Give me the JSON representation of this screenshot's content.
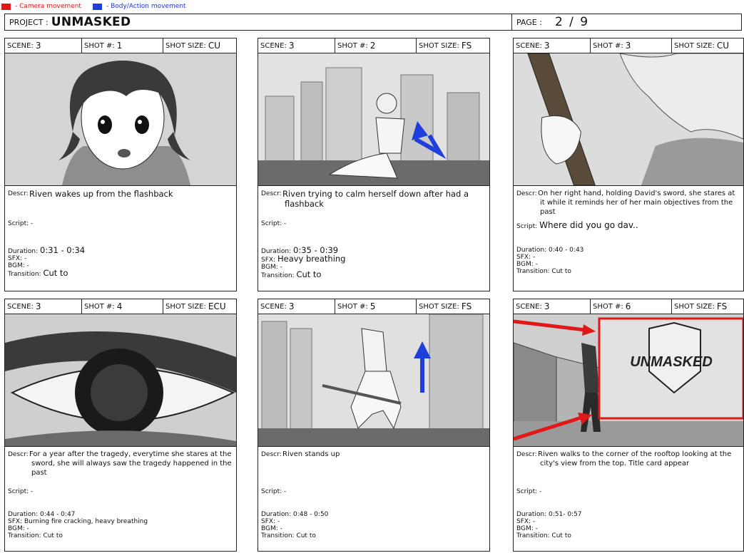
{
  "legend": {
    "camera_label": "- Camera movement",
    "body_label": "- Body/Action movement",
    "camera_color": "#e01818",
    "body_color": "#1f3fd9"
  },
  "header": {
    "project_label": "PROJECT :",
    "project_title": "UNMASKED",
    "page_label": "PAGE :",
    "page_value": "2 / 9"
  },
  "labels": {
    "scene": "SCENE:",
    "shot": "SHOT #:",
    "size": "SHOT SIZE:",
    "descr": "Descr:",
    "script": "Script:",
    "duration": "Duration:",
    "sfx": "SFX:",
    "bgm": "BGM:",
    "transition": "Transition:"
  },
  "panels": [
    {
      "scene": "3",
      "shot": "1",
      "size": "CU",
      "descr": "Riven wakes up from the flashback",
      "script": "-",
      "duration": "0:31 - 0:34",
      "sfx": "-",
      "bgm": "-",
      "transition": "Cut to"
    },
    {
      "scene": "3",
      "shot": "2",
      "size": "FS",
      "descr": "Riven trying to calm herself down after had a flashback",
      "script": "-",
      "duration": "0:35 - 0:39",
      "sfx": "Heavy breathing",
      "bgm": "-",
      "transition": "Cut to"
    },
    {
      "scene": "3",
      "shot": "3",
      "size": "CU",
      "descr": "On her right hand, holding David's sword, she stares at it while it reminds her of her main objectives from the past",
      "script": "Where did you go dav..",
      "duration": "0:40 - 0:43",
      "sfx": "-",
      "bgm": "-",
      "transition": "Cut to"
    },
    {
      "scene": "3",
      "shot": "4",
      "size": "ECU",
      "descr": "For a year after the tragedy, everytime she stares at the sword, she will always saw the tragedy happened in the past",
      "script": "-",
      "duration": "0:44 - 0:47",
      "sfx": "Burning fire cracking, heavy breathing",
      "bgm": "-",
      "transition": "Cut to"
    },
    {
      "scene": "3",
      "shot": "5",
      "size": "FS",
      "descr": "Riven stands up",
      "script": "-",
      "duration": "0:48 - 0:50",
      "sfx": "-",
      "bgm": "-",
      "transition": "Cut to"
    },
    {
      "scene": "3",
      "shot": "6",
      "size": "FS",
      "descr": "Riven walks to the corner of the rooftop looking at the city's view from the top. Title card appear",
      "script": "-",
      "duration": "0:51- 0:57",
      "sfx": "-",
      "bgm": "-",
      "transition": "Cut to",
      "title_card": "UNMASKED"
    }
  ]
}
